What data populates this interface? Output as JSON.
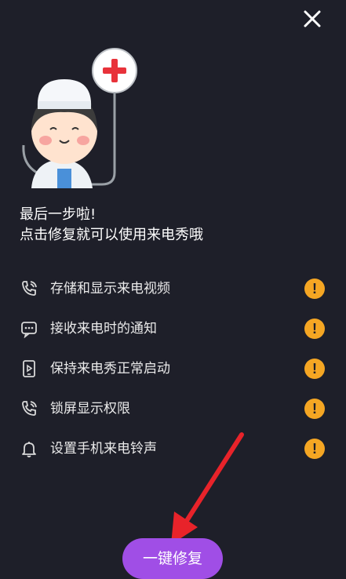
{
  "header": {
    "close_icon": "close-icon"
  },
  "illustration": {
    "name": "doctor-with-stethoscope",
    "cross_color": "#e8323a"
  },
  "heading": {
    "line1": "最后一步啦!",
    "line2": "点击修复就可以使用来电秀哦"
  },
  "permissions": [
    {
      "label": "存储和显示来电视频",
      "icon": "phone-ring-icon",
      "status": "warning"
    },
    {
      "label": "接收来电时的通知",
      "icon": "message-icon",
      "status": "warning"
    },
    {
      "label": "保持来电秀正常启动",
      "icon": "phone-play-icon",
      "status": "warning"
    },
    {
      "label": "锁屏显示权限",
      "icon": "phone-ring-icon",
      "status": "warning"
    },
    {
      "label": "设置手机来电铃声",
      "icon": "bell-icon",
      "status": "warning"
    }
  ],
  "warning_symbol": "!",
  "fix_button": {
    "label": "一键修复"
  },
  "colors": {
    "background": "#1e1f29",
    "warning": "#f5a623",
    "button": "#a04ee6",
    "arrow": "#e8232a"
  }
}
